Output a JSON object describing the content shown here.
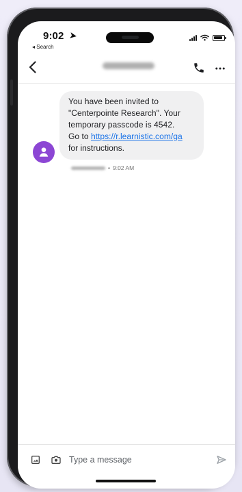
{
  "status_bar": {
    "time": "9:02",
    "back_app_label": "◂ Search"
  },
  "icons": {
    "back": "chevron-left-icon",
    "call": "phone-icon",
    "more": "more-horizontal-icon",
    "avatar": "person-icon",
    "gallery": "image-icon",
    "camera": "camera-icon",
    "send": "send-icon",
    "location": "location-arrow-icon"
  },
  "colors": {
    "accent": "#8c46d4",
    "link": "#1a73e8",
    "bubble": "#f0f0f1"
  },
  "message": {
    "line1": "You have been invited to",
    "line2": "\"Centerpointe Research\". Your",
    "line3": "temporary passcode is 4542.",
    "line4_prefix": "Go to ",
    "link": "https://r.learnistic.com/ga",
    "line5": "for instructions.",
    "time": "9:02 AM"
  },
  "composer": {
    "placeholder": "Type a message"
  }
}
